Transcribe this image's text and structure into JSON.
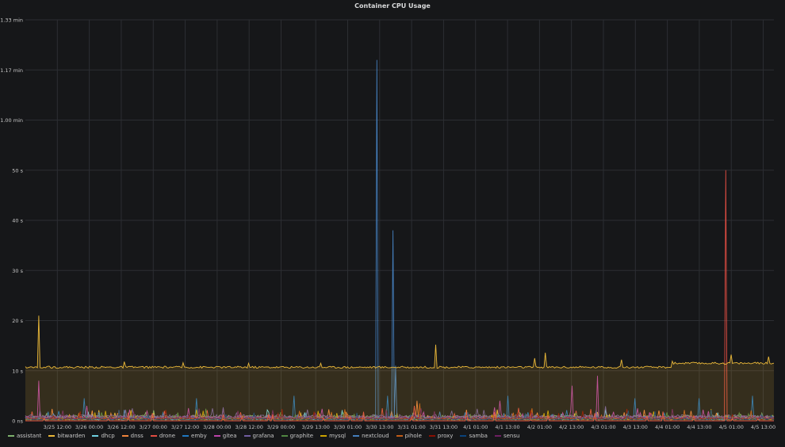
{
  "chart_data": {
    "type": "line",
    "title": "Container CPU Usage",
    "y_ticks": [
      "0 ns",
      "10 s",
      "20 s",
      "30 s",
      "40 s",
      "50 s",
      "1.00 min",
      "1.17 min",
      "1.33 min"
    ],
    "y_tick_values": [
      0,
      10,
      20,
      30,
      40,
      50,
      60,
      70,
      80
    ],
    "ylim": [
      0,
      80
    ],
    "x_ticks": [
      "3/25 12:00",
      "3/26 00:00",
      "3/26 12:00",
      "3/27 00:00",
      "3/27 12:00",
      "3/28 00:00",
      "3/28 12:00",
      "3/29 00:00",
      "3/29 13:00",
      "3/30 01:00",
      "3/30 13:00",
      "3/31 01:00",
      "3/31 13:00",
      "4/1 01:00",
      "4/1 13:00",
      "4/2 01:00",
      "4/2 13:00",
      "4/3 01:00",
      "4/3 13:00",
      "4/4 01:00",
      "4/4 13:00",
      "4/5 01:00",
      "4/5 13:00"
    ],
    "x_tick_values": [
      12,
      24,
      36,
      48,
      60,
      72,
      84,
      96,
      109,
      121,
      133,
      145,
      157,
      169,
      181,
      193,
      205,
      217,
      229,
      241,
      253,
      265,
      277
    ],
    "xlim": [
      0,
      281
    ],
    "grid": true,
    "legend_position": "bottom",
    "series": [
      {
        "name": "assistant",
        "color": "#7eb26d",
        "baseline": 0.8,
        "spikes": []
      },
      {
        "name": "bitwarden",
        "color": "#eab839",
        "baseline": 0.4,
        "spikes": []
      },
      {
        "name": "dhcp",
        "color": "#6ed0e0",
        "baseline": 0.3,
        "spikes": []
      },
      {
        "name": "dnss",
        "color": "#ef843c",
        "baseline": 0.5,
        "spikes": [
          [
            147,
            4
          ],
          [
            250,
            2
          ]
        ]
      },
      {
        "name": "drone",
        "color": "#e24d42",
        "baseline": 0.5,
        "spikes": [
          [
            52,
            2
          ],
          [
            146,
            3
          ]
        ]
      },
      {
        "name": "emby",
        "color": "#1f78c1",
        "baseline": 0.6,
        "spikes": [
          [
            22,
            4.5
          ],
          [
            64,
            4.5
          ],
          [
            101,
            5
          ],
          [
            136,
            5
          ],
          [
            181,
            5
          ],
          [
            229,
            4.5
          ],
          [
            253,
            4.5
          ],
          [
            273,
            5
          ]
        ]
      },
      {
        "name": "gitea",
        "color": "#ba43a9",
        "baseline": 0.7,
        "spikes": [
          [
            5,
            8
          ],
          [
            23,
            3
          ],
          [
            178,
            4
          ],
          [
            205,
            7
          ],
          [
            215,
            9
          ],
          [
            230,
            2.5
          ]
        ]
      },
      {
        "name": "grafana",
        "color": "#705da0",
        "baseline": 0.9,
        "spikes": [
          [
            40,
            2.5
          ],
          [
            70,
            2.5
          ],
          [
            160,
            2
          ]
        ]
      },
      {
        "name": "graphite",
        "color": "#508642",
        "baseline": 0.5,
        "spikes": []
      },
      {
        "name": "mysql",
        "color": "#cca300",
        "baseline": 0.3,
        "spikes": [
          [
            30,
            2
          ],
          [
            110,
            2
          ]
        ]
      },
      {
        "name": "nextcloud",
        "color": "#447ebc",
        "baseline": 0.4,
        "spikes": [
          [
            132,
            72
          ],
          [
            138,
            38
          ],
          [
            139,
            11
          ]
        ]
      },
      {
        "name": "pihole",
        "color": "#c15c17",
        "baseline": 0.4,
        "spikes": [
          [
            148,
            3.5
          ],
          [
            190,
            2.5
          ]
        ]
      },
      {
        "name": "proxy",
        "color": "#890f02",
        "baseline": 0.4,
        "spikes": [
          [
            200,
            1.5
          ]
        ]
      },
      {
        "name": "samba",
        "color": "#0a437c",
        "baseline": 0.3,
        "spikes": []
      },
      {
        "name": "sensu",
        "color": "#6d1f62",
        "baseline": 0.6,
        "spikes": [
          [
            80,
            2
          ],
          [
            190,
            1.5
          ]
        ]
      },
      {
        "name": "proxy-peak",
        "color": "#e24d42",
        "baseline": 0,
        "spikes": [
          [
            263,
            50
          ]
        ]
      },
      {
        "name": "bitwarden-total",
        "color": "#eab839",
        "baseline": 10.7,
        "step": [
          [
            243,
            11.5
          ]
        ],
        "spikes": [
          [
            5,
            21
          ],
          [
            37,
            11.8
          ],
          [
            59,
            11.6
          ],
          [
            84,
            11.5
          ],
          [
            111,
            11.5
          ],
          [
            154,
            15.2
          ],
          [
            191,
            12.5
          ],
          [
            195,
            13.6
          ],
          [
            224,
            12.2
          ],
          [
            243,
            11.9
          ],
          [
            265,
            13.2
          ],
          [
            279,
            12.8
          ]
        ],
        "fill": true
      }
    ],
    "legend": [
      "assistant",
      "bitwarden",
      "dhcp",
      "dnss",
      "drone",
      "emby",
      "gitea",
      "grafana",
      "graphite",
      "mysql",
      "nextcloud",
      "pihole",
      "proxy",
      "samba",
      "sensu"
    ]
  },
  "colors": {
    "background": "#161719",
    "grid": "#2c2e33",
    "text": "#d8d9da"
  }
}
